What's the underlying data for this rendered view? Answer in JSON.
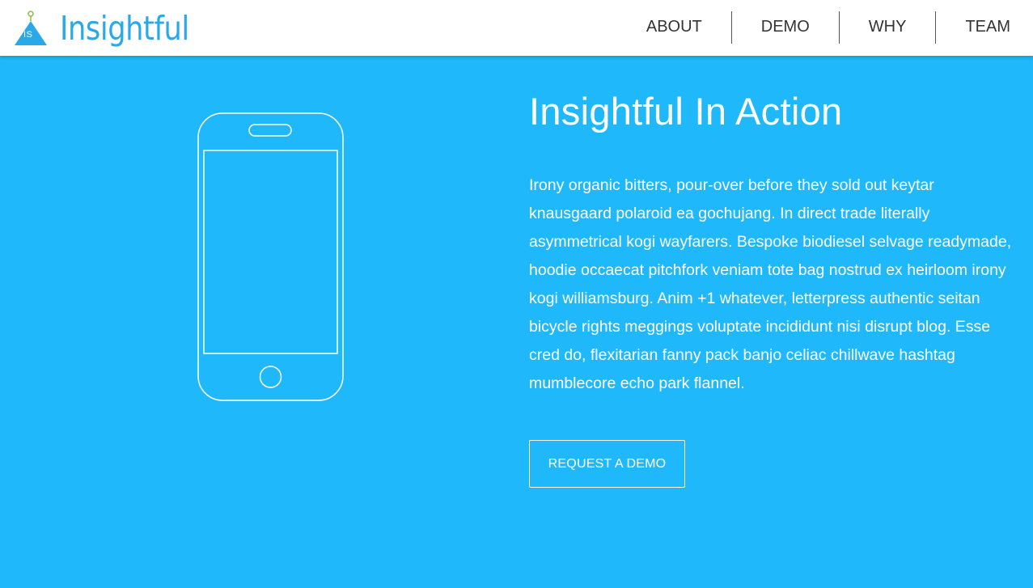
{
  "brand": {
    "name": "Insightful",
    "mark_text": "IS",
    "color": "#29a9e8"
  },
  "nav": {
    "items": [
      {
        "label": "ABOUT"
      },
      {
        "label": "DEMO"
      },
      {
        "label": "WHY"
      },
      {
        "label": "TEAM"
      }
    ]
  },
  "hero": {
    "background": "#1fb8fb",
    "icon": "phone-outline-icon",
    "title": "Insightful In Action",
    "body": "Irony organic bitters, pour-over before they sold out keytar knausgaard polaroid ea gochujang. In direct trade literally asymmetrical kogi wayfarers. Bespoke biodiesel selvage readymade, hoodie occaecat pitchfork veniam tote bag nostrud ex heirloom irony kogi williamsburg. Anim +1 whatever, letterpress authentic seitan bicycle rights meggings voluptate incididunt nisi disrupt blog. Esse cred do, flexitarian fanny pack banjo celiac chillwave hashtag mumblecore echo park flannel.",
    "cta_label": "REQUEST A DEMO"
  }
}
